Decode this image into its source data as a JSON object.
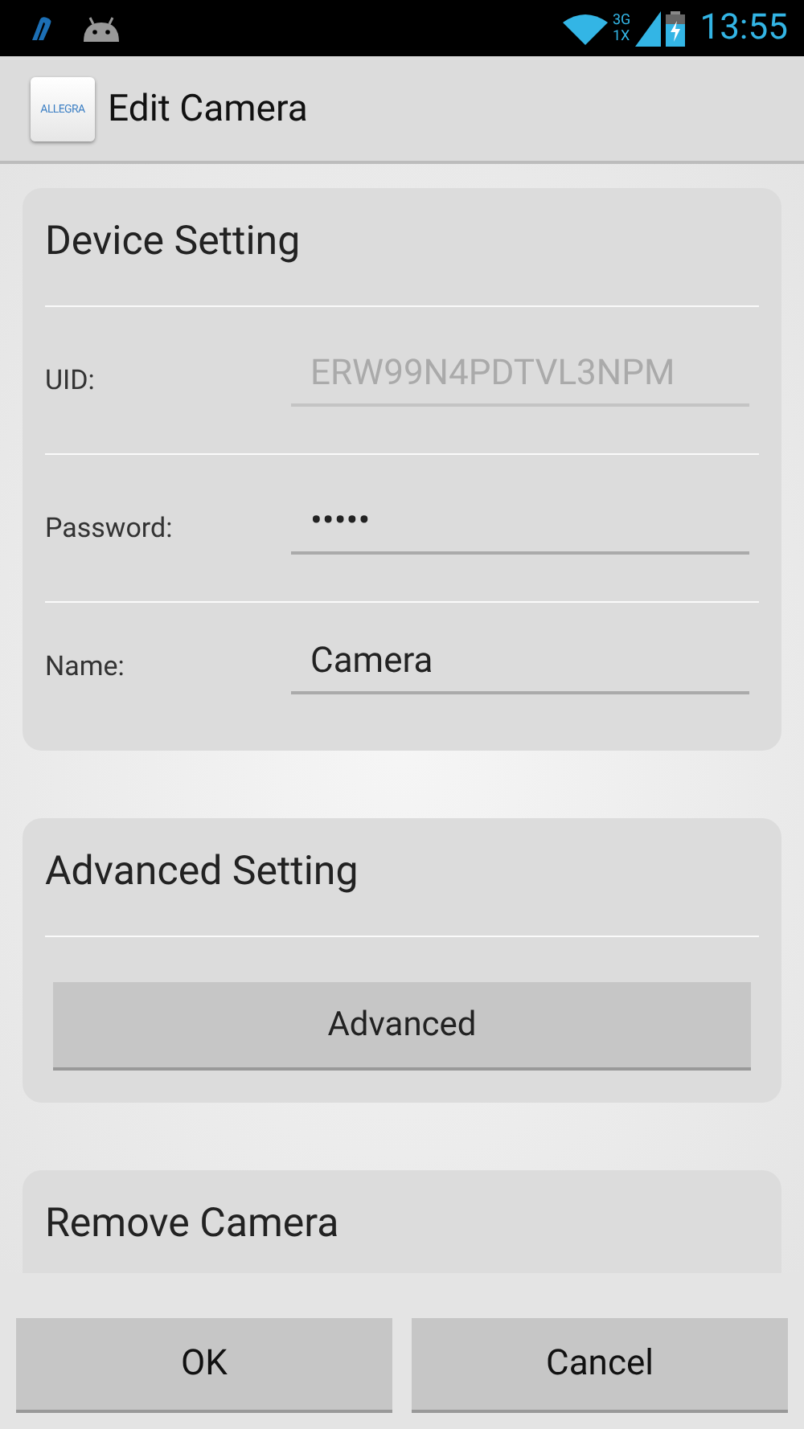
{
  "status_bar": {
    "network_top": "3G",
    "network_bottom": "1X",
    "time": "13:55"
  },
  "action_bar": {
    "logo_text": "ALLEGRA",
    "title": "Edit Camera"
  },
  "sections": [
    {
      "title": "Device Setting",
      "fields": [
        {
          "label": "UID:",
          "value": "ERW99N4PDTVL3NPM",
          "disabled": true
        },
        {
          "label": "Password:",
          "value": "•••••",
          "disabled": false
        },
        {
          "label": "Name:",
          "value": "Camera",
          "disabled": false
        }
      ]
    },
    {
      "title": "Advanced Setting",
      "button": "Advanced"
    },
    {
      "title": "Remove Camera"
    }
  ],
  "buttons": [
    "OK",
    "Cancel"
  ]
}
